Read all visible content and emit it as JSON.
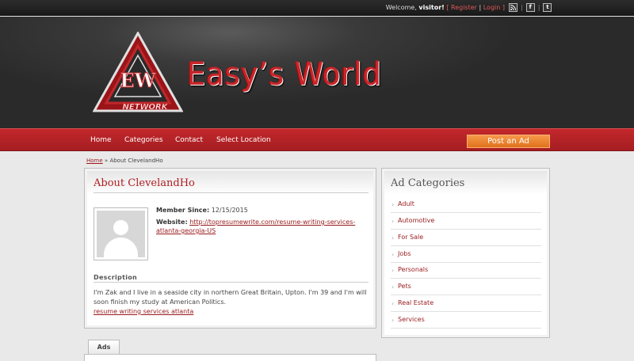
{
  "topbar": {
    "welcome_prefix": "Welcome,",
    "user": "visitor!",
    "bracket_open": "[",
    "register": "Register",
    "pipe": "|",
    "login": "Login",
    "bracket_close": "]",
    "rss_icon": "rss-icon",
    "facebook_icon": "facebook-icon",
    "twitter_icon": "twitter-icon"
  },
  "header": {
    "site_title": "Easy’s World",
    "logo_icon": "ew-triangle-logo",
    "logo_center_text": "EW",
    "logo_bottom_text": "NETWORK"
  },
  "nav": {
    "items": [
      "Home",
      "Categories",
      "Contact",
      "Select Location"
    ],
    "post_ad": "Post an Ad"
  },
  "breadcrumb": {
    "home": "Home",
    "separator": "»",
    "current": "About ClevelandHo"
  },
  "profile": {
    "title": "About ClevelandHo",
    "member_since_label": "Member Since:",
    "member_since_value": "12/15/2015",
    "website_label": "Website:",
    "website_value_line1": "http://topresumewrite.com/resume-writing-services-",
    "website_value_line2": "atlanta-georgia-US",
    "avatar_icon": "default-avatar-icon",
    "description_heading": "Description",
    "description_text": "I'm Zak and I live in a seaside city in northern Great Britain, Upton. I'm 39 and I'm will soon finish my study at American Politics.",
    "description_link": "resume writing services atlanta"
  },
  "tabs": {
    "ads": "Ads"
  },
  "sidebar": {
    "title": "Ad Categories",
    "arrow": "›",
    "categories": [
      "Adult",
      "Automotive",
      "For Sale",
      "Jobs",
      "Personals",
      "Pets",
      "Real Estate",
      "Services"
    ]
  },
  "colors": {
    "brand_red": "#c2272b",
    "link_red": "#9a1a1d",
    "post_orange": "#f08a36",
    "dark_header": "#2a2a2a"
  }
}
